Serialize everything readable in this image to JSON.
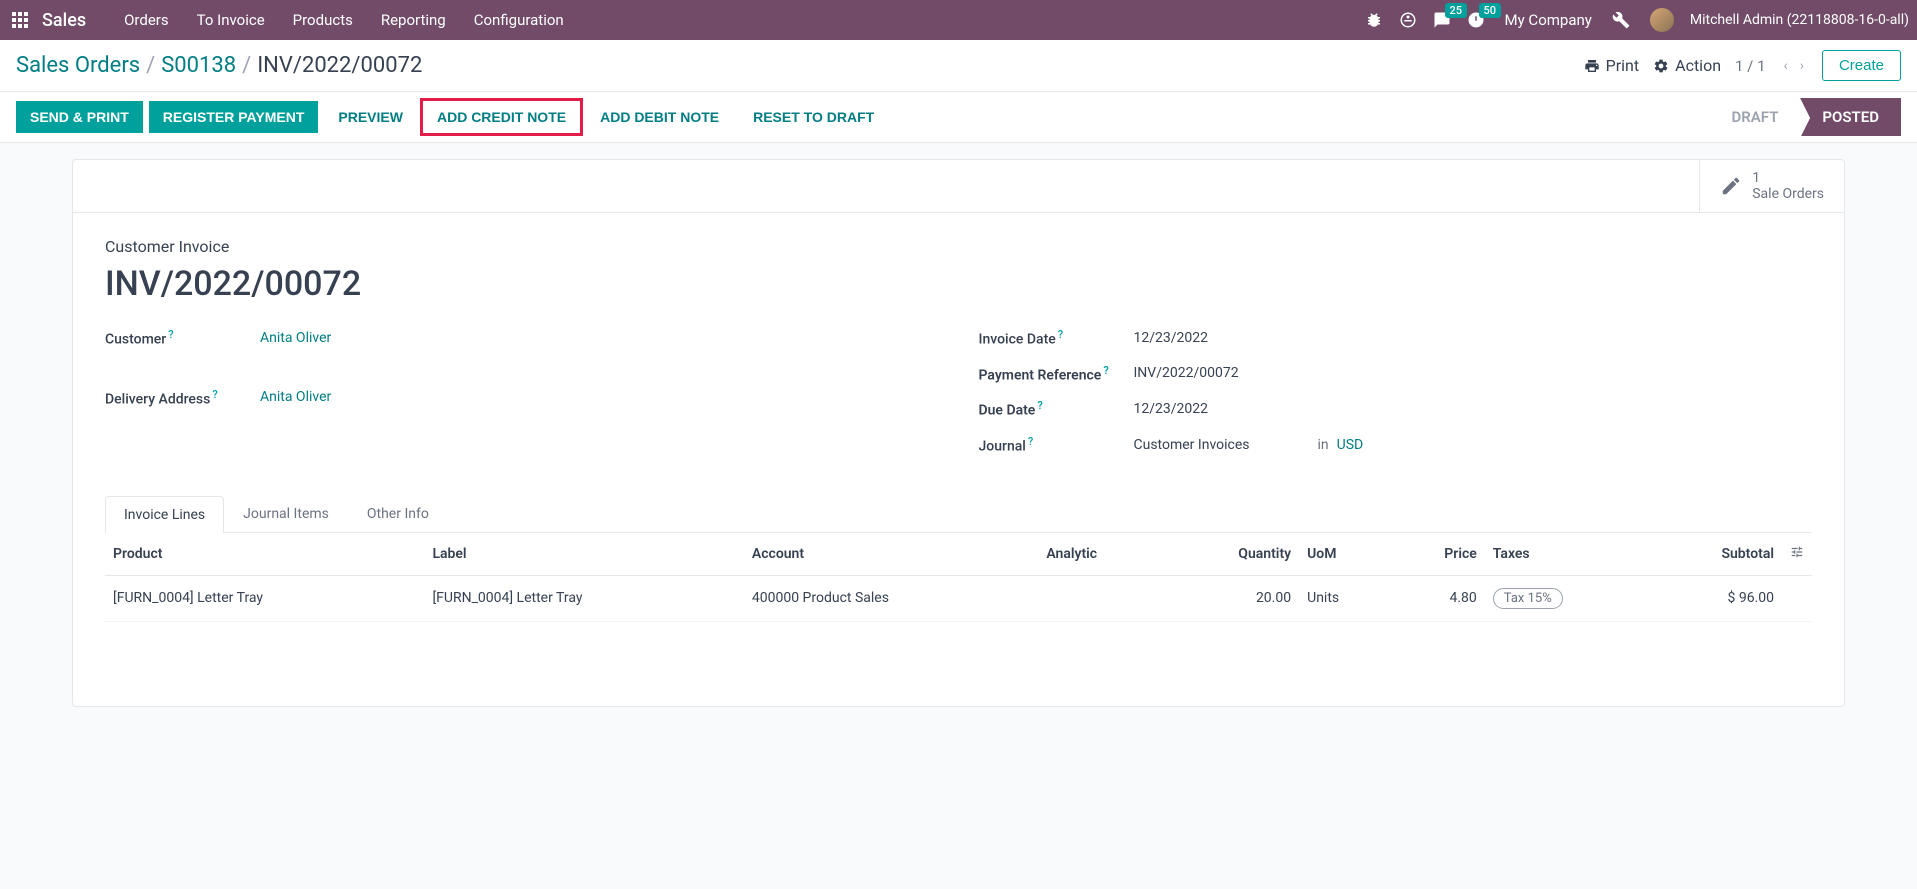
{
  "topbar": {
    "app_name": "Sales",
    "nav": [
      "Orders",
      "To Invoice",
      "Products",
      "Reporting",
      "Configuration"
    ],
    "messaging_count": "25",
    "activities_count": "50",
    "company": "My Company",
    "user": "Mitchell Admin (22118808-16-0-all)"
  },
  "breadcrumb": {
    "items": [
      "Sales Orders",
      "S00138",
      "INV/2022/00072"
    ],
    "print": "Print",
    "action": "Action",
    "pager": "1 / 1",
    "create": "Create"
  },
  "actions": {
    "send_print": "SEND & PRINT",
    "register_payment": "REGISTER PAYMENT",
    "preview": "PREVIEW",
    "add_credit_note": "ADD CREDIT NOTE",
    "add_debit_note": "ADD DEBIT NOTE",
    "reset_draft": "RESET TO DRAFT"
  },
  "status": {
    "draft": "DRAFT",
    "posted": "POSTED"
  },
  "stat": {
    "count": "1",
    "label": "Sale Orders"
  },
  "form": {
    "subtitle": "Customer Invoice",
    "title": "INV/2022/00072",
    "customer_label": "Customer",
    "customer": "Anita Oliver",
    "delivery_label": "Delivery Address",
    "delivery": "Anita Oliver",
    "invoice_date_label": "Invoice Date",
    "invoice_date": "12/23/2022",
    "payment_ref_label": "Payment Reference",
    "payment_ref": "INV/2022/00072",
    "due_date_label": "Due Date",
    "due_date": "12/23/2022",
    "journal_label": "Journal",
    "journal": "Customer Invoices",
    "in_label": "in",
    "currency": "USD"
  },
  "tabs": [
    "Invoice Lines",
    "Journal Items",
    "Other Info"
  ],
  "table": {
    "headers": {
      "product": "Product",
      "label": "Label",
      "account": "Account",
      "analytic": "Analytic",
      "quantity": "Quantity",
      "uom": "UoM",
      "price": "Price",
      "taxes": "Taxes",
      "subtotal": "Subtotal"
    },
    "rows": [
      {
        "product": "[FURN_0004] Letter Tray",
        "label": "[FURN_0004] Letter Tray",
        "account": "400000 Product Sales",
        "analytic": "",
        "quantity": "20.00",
        "uom": "Units",
        "price": "4.80",
        "taxes": "Tax 15%",
        "subtotal": "$ 96.00"
      }
    ]
  }
}
